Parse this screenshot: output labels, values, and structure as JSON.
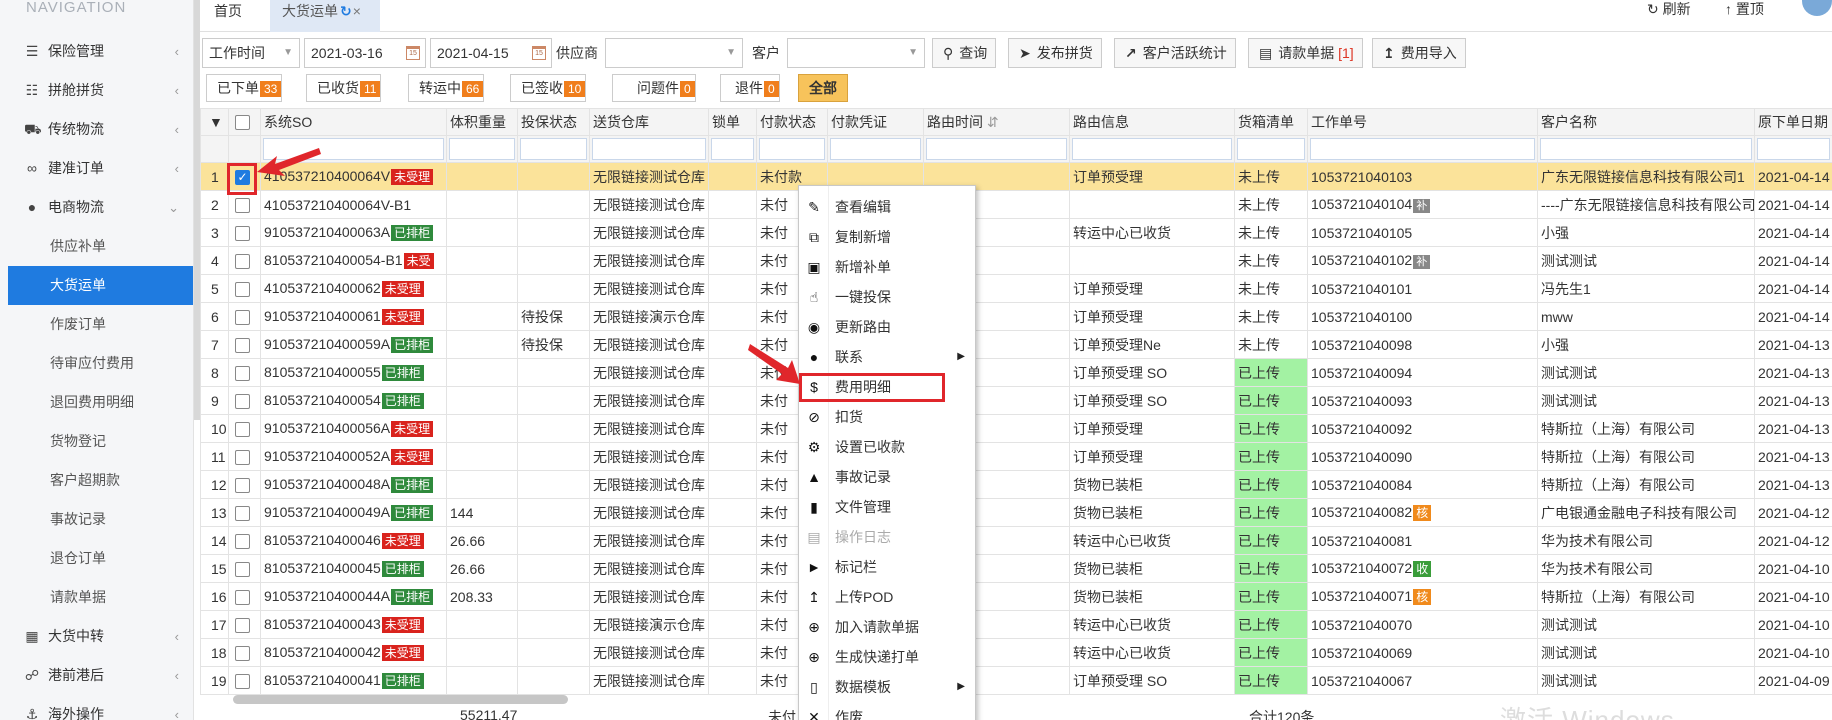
{
  "sidebar": {
    "title": "NAVIGATION",
    "items": [
      {
        "label": "保险管理",
        "icon": "clipboard-icon"
      },
      {
        "label": "拼舱拼货",
        "icon": "table-list-icon"
      },
      {
        "label": "传统物流",
        "icon": "truck-icon"
      },
      {
        "label": "建准订单",
        "icon": "link-icon"
      },
      {
        "label": "电商物流",
        "icon": "globe-icon",
        "expanded": true
      }
    ],
    "sub_items": [
      "供应补单",
      "大货运单",
      "作废订单",
      "待审应付费用",
      "退回费用明细",
      "货物登记",
      "客户超期款",
      "事故记录",
      "退仓订单",
      "请款单据"
    ],
    "active_sub": "大货运单",
    "bottom_items": [
      {
        "label": "大货中转",
        "icon": "grid-icon"
      },
      {
        "label": "港前港后",
        "icon": "share-icon"
      },
      {
        "label": "海外操作",
        "icon": "ship-icon"
      }
    ]
  },
  "tabs": {
    "home": "首页",
    "current": "大货运单",
    "refresh": "刷新",
    "top": "置顶"
  },
  "filter": {
    "time_type": "工作时间",
    "date_from": "2021-03-16",
    "date_to": "2021-04-15",
    "supplier_label": "供应商",
    "supplier_value": "",
    "customer_label": "客户",
    "customer_value": "",
    "buttons": {
      "query": "查询",
      "publish": "发布拼货",
      "stats": "客户活跃统计",
      "payment_request": "请款单据",
      "payment_count": "[1]",
      "import": "费用导入"
    }
  },
  "status_buttons": [
    {
      "label": "已下单",
      "count": "33"
    },
    {
      "label": "已收货",
      "count": "11"
    },
    {
      "label": "转运中",
      "count": "66"
    },
    {
      "label": "已签收",
      "count": "10"
    },
    {
      "label": "问题件",
      "count": "0"
    },
    {
      "label": "退件",
      "count": "0"
    },
    {
      "label": "全部",
      "count": ""
    }
  ],
  "table": {
    "columns": [
      "系统SO",
      "体积重量",
      "投保状态",
      "送货仓库",
      "锁单",
      "付款状态",
      "付款凭证",
      "路由时间",
      "路由信息",
      "货箱清单",
      "工作单号",
      "客户名称",
      "原下单日期"
    ],
    "rows": [
      {
        "n": "1",
        "so": "410537210400064V",
        "so_badge": "未受理",
        "badge_type": "red",
        "weight": "",
        "insure": "",
        "warehouse": "无限链接测试仓库",
        "pay": "未付款",
        "route": "订单预受理",
        "box": "未上传",
        "work": "1053721040103",
        "work_badge": "",
        "cust": "广东无限链接信息科技有限公司1",
        "date": "2021-04-14 10:42:00",
        "checked": true
      },
      {
        "n": "2",
        "so": "410537210400064V-B1",
        "so_badge": "",
        "badge_type": "",
        "weight": "",
        "insure": "",
        "warehouse": "无限链接测试仓库",
        "pay": "未付",
        "route": "",
        "box": "未上传",
        "work": "1053721040104",
        "work_badge": "补",
        "cust": "----广东无限链接信息科技有限公司",
        "date": "2021-04-14 10:42:00"
      },
      {
        "n": "3",
        "so": "910537210400063A",
        "so_badge": "已排柜",
        "badge_type": "green",
        "weight": "",
        "insure": "",
        "warehouse": "无限链接测试仓库",
        "pay": "未付",
        "route": "转运中心已收货",
        "box": "未上传",
        "work": "1053721040105",
        "work_badge": "",
        "cust": "小强",
        "date": "2021-04-14 10:42:00"
      },
      {
        "n": "4",
        "so": "810537210400054-B1",
        "so_badge": "未受",
        "badge_type": "red",
        "weight": "",
        "insure": "",
        "warehouse": "无限链接测试仓库",
        "pay": "未付",
        "route": "",
        "box": "未上传",
        "work": "1053721040102",
        "work_badge": "补",
        "cust": "测试测试",
        "date": "2021-04-14 10:15:00"
      },
      {
        "n": "5",
        "so": "410537210400062",
        "so_badge": "未受理",
        "badge_type": "red",
        "weight": "",
        "insure": "",
        "warehouse": "无限链接测试仓库",
        "pay": "未付",
        "route": "订单预受理",
        "box": "未上传",
        "work": "1053721040101",
        "work_badge": "",
        "cust": "冯先生1",
        "date": "2021-04-14 09:41:00"
      },
      {
        "n": "6",
        "so": "910537210400061",
        "so_badge": "未受理",
        "badge_type": "red",
        "weight": "",
        "insure": "待投保",
        "warehouse": "无限链接演示仓库",
        "pay": "未付",
        "route": "订单预受理",
        "box": "未上传",
        "work": "1053721040100",
        "work_badge": "",
        "cust": "mww",
        "date": "2021-04-14 09:05:00"
      },
      {
        "n": "7",
        "so": "910537210400059A",
        "so_badge": "已排柜",
        "badge_type": "green",
        "weight": "",
        "insure": "待投保",
        "warehouse": "无限链接测试仓库",
        "pay": "未付",
        "route": "订单预受理Ne",
        "box": "未上传",
        "work": "1053721040098",
        "work_badge": "",
        "cust": "小强",
        "date": "2021-04-13 17:20:00"
      },
      {
        "n": "8",
        "so": "810537210400055",
        "so_badge": "已排柜",
        "badge_type": "green",
        "weight": "",
        "insure": "",
        "warehouse": "无限链接测试仓库",
        "pay": "未付",
        "route": "订单预受理 SO",
        "box": "已上传",
        "work": "1053721040094",
        "work_badge": "",
        "cust": "测试测试",
        "date": "2021-04-13 14:39:00"
      },
      {
        "n": "9",
        "so": "810537210400054",
        "so_badge": "已排柜",
        "badge_type": "green",
        "weight": "",
        "insure": "",
        "warehouse": "无限链接测试仓库",
        "pay": "未付",
        "route": "订单预受理 SO",
        "box": "已上传",
        "work": "1053721040093",
        "work_badge": "",
        "cust": "测试测试",
        "date": "2021-04-13 14:37:00"
      },
      {
        "n": "10",
        "so": "910537210400056A",
        "so_badge": "未受理",
        "badge_type": "red",
        "weight": "",
        "insure": "",
        "warehouse": "无限链接测试仓库",
        "pay": "未付",
        "route": "订单预受理",
        "box": "已上传",
        "work": "1053721040092",
        "work_badge": "",
        "cust": "特斯拉（上海）有限公司",
        "date": "2021-04-13 14:23:00"
      },
      {
        "n": "11",
        "so": "910537210400052A",
        "so_badge": "未受理",
        "badge_type": "red",
        "weight": "",
        "insure": "",
        "warehouse": "无限链接测试仓库",
        "pay": "未付",
        "route": "订单预受理",
        "box": "已上传",
        "work": "1053721040090",
        "work_badge": "",
        "cust": "特斯拉（上海）有限公司",
        "date": "2021-04-13 10:46:00"
      },
      {
        "n": "12",
        "so": "910537210400048A",
        "so_badge": "已排柜",
        "badge_type": "green",
        "weight": "",
        "insure": "",
        "warehouse": "无限链接测试仓库",
        "pay": "未付",
        "route": "货物已装柜",
        "box": "已上传",
        "work": "1053721040084",
        "work_badge": "",
        "cust": "特斯拉（上海）有限公司",
        "date": "2021-04-13 09:03:00"
      },
      {
        "n": "13",
        "so": "910537210400049A",
        "so_badge": "已排柜",
        "badge_type": "green",
        "weight": "144",
        "insure": "",
        "warehouse": "无限链接测试仓库",
        "pay": "未付",
        "route": "货物已装柜",
        "box": "已上传",
        "work": "1053721040082",
        "work_badge": "核",
        "cust": "广电银通金融电子科技有限公司",
        "date": "2021-04-12 10:38:00"
      },
      {
        "n": "14",
        "so": "810537210400046",
        "so_badge": "未受理",
        "badge_type": "red",
        "weight": "26.66",
        "insure": "",
        "warehouse": "无限链接测试仓库",
        "pay": "未付",
        "route": "转运中心已收货",
        "box": "已上传",
        "work": "1053721040081",
        "work_badge": "",
        "cust": "华为技术有限公司",
        "date": "2021-04-12 08:48:00"
      },
      {
        "n": "15",
        "so": "810537210400045",
        "so_badge": "已排柜",
        "badge_type": "green",
        "weight": "26.66",
        "insure": "",
        "warehouse": "无限链接测试仓库",
        "pay": "未付",
        "route": "货物已装柜",
        "box": "已上传",
        "work": "1053721040072",
        "work_badge": "收",
        "cust": "华为技术有限公司",
        "date": "2021-04-10 10:09:00"
      },
      {
        "n": "16",
        "so": "910537210400044A",
        "so_badge": "已排柜",
        "badge_type": "green",
        "weight": "208.33",
        "insure": "",
        "warehouse": "无限链接测试仓库",
        "pay": "未付",
        "route": "货物已装柜",
        "box": "已上传",
        "work": "1053721040071",
        "work_badge": "核",
        "cust": "特斯拉（上海）有限公司",
        "date": "2021-04-10 10:07:00"
      },
      {
        "n": "17",
        "so": "810537210400043",
        "so_badge": "未受理",
        "badge_type": "red",
        "weight": "",
        "insure": "",
        "warehouse": "无限链接演示仓库",
        "pay": "未付",
        "route": "转运中心已收货",
        "box": "已上传",
        "work": "1053721040070",
        "work_badge": "",
        "cust": "测试测试",
        "date": "2021-04-10 08:52:00"
      },
      {
        "n": "18",
        "so": "810537210400042",
        "so_badge": "未受理",
        "badge_type": "red",
        "weight": "",
        "insure": "",
        "warehouse": "无限链接测试仓库",
        "pay": "未付",
        "route": "转运中心已收货",
        "box": "已上传",
        "work": "1053721040069",
        "work_badge": "",
        "cust": "测试测试",
        "date": "2021-04-10 08:47:00"
      },
      {
        "n": "19",
        "so": "810537210400041",
        "so_badge": "已排柜",
        "badge_type": "green",
        "weight": "",
        "insure": "",
        "warehouse": "无限链接测试仓库",
        "pay": "未付",
        "route": "订单预受理 SO",
        "box": "已上传",
        "work": "1053721040067",
        "work_badge": "",
        "cust": "测试测试",
        "date": "2021-04-09 17:20:00"
      }
    ],
    "summary_weight": "55211.47",
    "summary_pay": "未付",
    "summary_total": "合计120条"
  },
  "context_menu": [
    {
      "label": "查看编辑",
      "icon": "pencil-icon"
    },
    {
      "label": "复制新增",
      "icon": "copy-icon"
    },
    {
      "label": "新增补单",
      "icon": "paste-icon"
    },
    {
      "label": "一键投保",
      "icon": "hand-pointer-icon"
    },
    {
      "label": "更新路由",
      "icon": "globe-icon"
    },
    {
      "label": "联系",
      "icon": "chat-icon",
      "submenu": true
    },
    {
      "label": "费用明细",
      "icon": "dollar-icon",
      "highlight": true
    },
    {
      "label": "扣货",
      "icon": "ban-icon"
    },
    {
      "label": "设置已收款",
      "icon": "gear-icon"
    },
    {
      "label": "事故记录",
      "icon": "warning-icon"
    },
    {
      "label": "文件管理",
      "icon": "file-icon"
    },
    {
      "label": "操作日志",
      "icon": "list-icon",
      "disabled": true
    },
    {
      "label": "标记栏",
      "icon": "tag-icon"
    },
    {
      "label": "上传POD",
      "icon": "upload-icon"
    },
    {
      "label": "加入请款单据",
      "icon": "plus-circle-icon"
    },
    {
      "label": "生成快递打单",
      "icon": "plus-circle-icon"
    },
    {
      "label": "数据模板",
      "icon": "file-text-icon",
      "submenu": true
    },
    {
      "label": "作废",
      "icon": "close-icon"
    }
  ],
  "watermark": "激活 Windows",
  "colors": {
    "accent": "#1f7be0",
    "selected_row": "#fbe39a",
    "uploaded_cell": "#a3f2a3",
    "badge_red": "#d9231d",
    "badge_green": "#2f8a3c",
    "count_orange": "#f07e1c",
    "highlight_box": "#e0262b"
  }
}
